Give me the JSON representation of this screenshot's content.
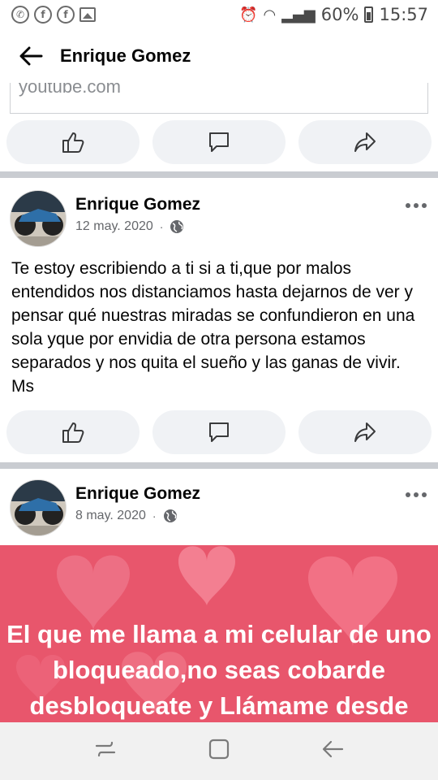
{
  "status_bar": {
    "left_icons": [
      "whatsapp-icon",
      "facebook-icon",
      "facebook-icon",
      "gallery-icon"
    ],
    "battery": "60%",
    "time": "15:57"
  },
  "header": {
    "title": "Enrique Gomez"
  },
  "link_card": {
    "domain": "youtube.com"
  },
  "action_icons": [
    "like-icon",
    "comment-icon",
    "share-icon"
  ],
  "posts": [
    {
      "author": "Enrique Gomez",
      "date": "12 may. 2020",
      "separator": "·",
      "text": "Te estoy escribiendo a ti si a ti,que por malos entendidos nos distanciamos hasta dejarnos de ver y pensar qué nuestras miradas se confundieron en una sola yque por envidia de otra persona estamos separados y nos quita el sueño y las ganas de vivir. Ms"
    },
    {
      "author": "Enrique Gomez",
      "date": "8 may. 2020",
      "separator": "·",
      "image_text": "El que me llama a mi celular de uno bloqueado,no seas cobarde desbloqueate y Llámame desde"
    }
  ],
  "colors": {
    "accent_bg": "#f0f2f5",
    "separator": "#c9ccd1",
    "image_bg": "#e8566c"
  },
  "nav_icons": [
    "recent-apps-icon",
    "home-icon",
    "back-icon"
  ]
}
